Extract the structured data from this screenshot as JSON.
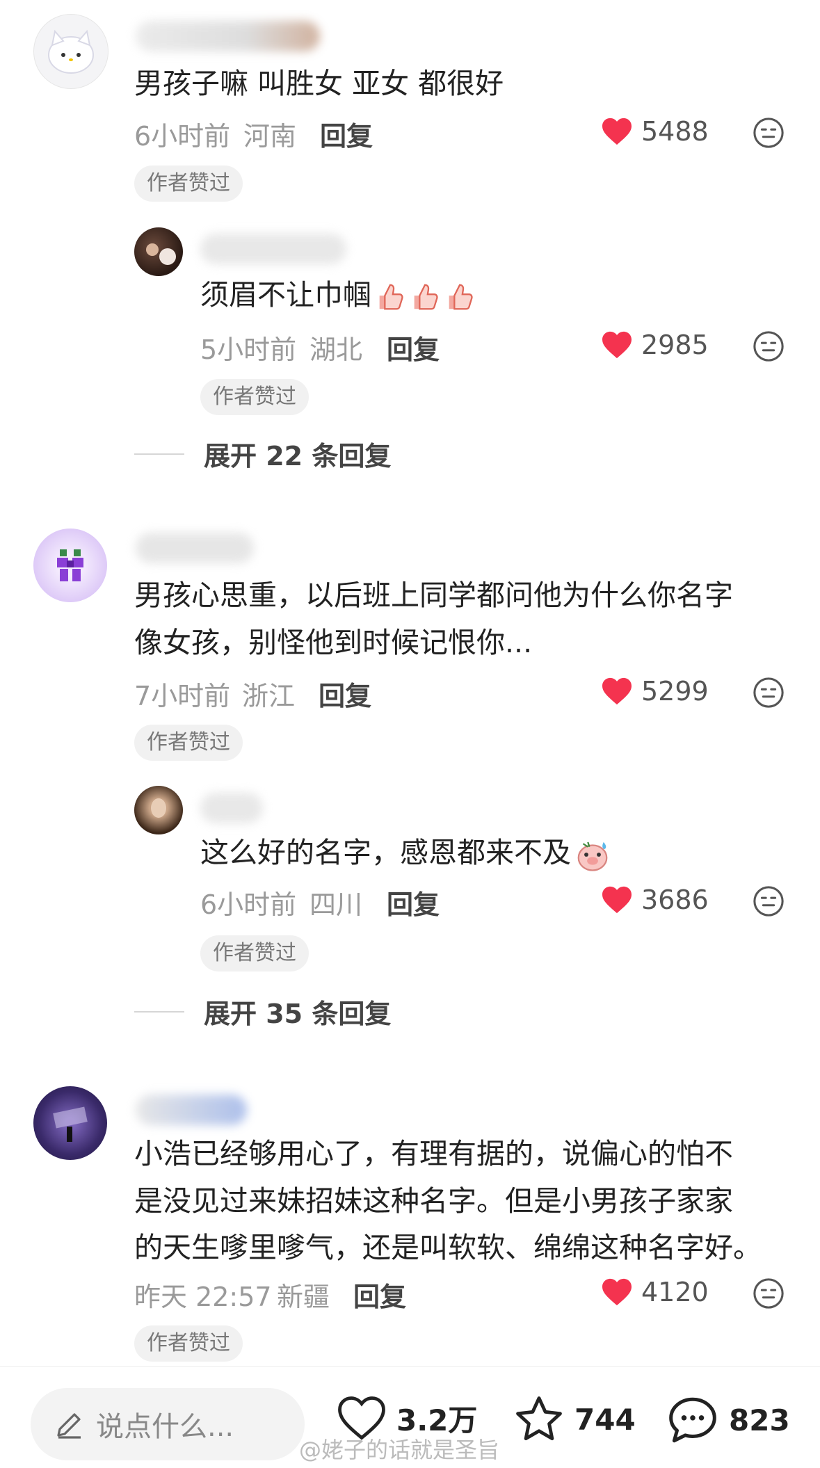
{
  "comments": [
    {
      "text": "男孩子嘛 叫胜女 亚女 都很好",
      "time": "6小时前",
      "location": "河南",
      "reply_label": "回复",
      "likes": "5488",
      "badge": "作者赞过"
    },
    {
      "text": "须眉不让巾帼",
      "time": "5小时前",
      "location": "湖北",
      "reply_label": "回复",
      "likes": "2985",
      "badge": "作者赞过"
    },
    {
      "text_line1": "男孩心思重，以后班上同学都问他为什么你名字",
      "text_line2": "像女孩，别怪他到时候记恨你...",
      "time": "7小时前",
      "location": "浙江",
      "reply_label": "回复",
      "likes": "5299",
      "badge": "作者赞过"
    },
    {
      "text": "这么好的名字，感恩都来不及",
      "time": "6小时前",
      "location": "四川",
      "reply_label": "回复",
      "likes": "3686",
      "badge": "作者赞过"
    },
    {
      "text_line1": "小浩已经够用心了，有理有据的，说偏心的怕不",
      "text_line2": "是没见过来妹招妹这种名字。但是小男孩子家家",
      "text_line3": "的天生嗲里嗲气，还是叫软软、绵绵这种名字好。",
      "time": "昨天 22:57",
      "location": "新疆",
      "reply_label": "回复",
      "likes": "4120",
      "badge": "作者赞过"
    }
  ],
  "expand_1": "展开 22 条回复",
  "expand_2": "展开 35 条回复",
  "bottom_bar": {
    "input_placeholder": "说点什么...",
    "likes": "3.2万",
    "favorites": "744",
    "comments": "823"
  },
  "watermark": "@姥子的话就是圣旨",
  "colors": {
    "heart": "#f4334f",
    "meta": "#9a9a9a",
    "badge_bg": "#f1f1f1"
  },
  "icons": [
    "heart-icon",
    "meh-face-icon",
    "pencil-icon",
    "star-icon",
    "chat-bubble-icon",
    "thumbs-up-emoji",
    "sweat-pig-emoji"
  ]
}
